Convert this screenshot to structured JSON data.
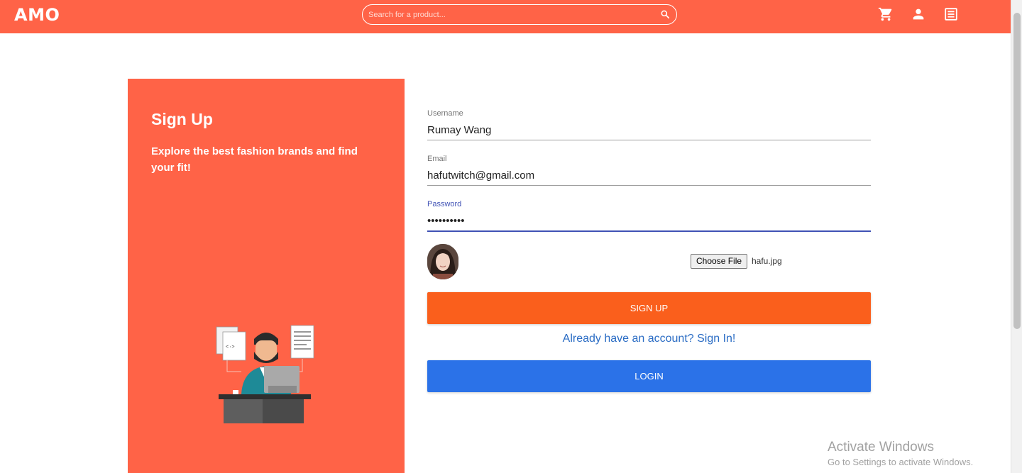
{
  "app": {
    "logo_text": "AMO",
    "brand_color": "#ff6347"
  },
  "header": {
    "search_placeholder": "Search for a product...",
    "icons": [
      "search-icon",
      "cart-icon",
      "user-icon",
      "orders-icon"
    ]
  },
  "panel": {
    "title": "Sign Up",
    "tagline": "Explore the best fashion brands and find your fit!",
    "illustration": "developer-at-desk-illustration"
  },
  "form": {
    "username": {
      "label": "Username",
      "value": "Rumay Wang"
    },
    "email": {
      "label": "Email",
      "value": "hafutwitch@gmail.com"
    },
    "password": {
      "label": "Password",
      "value": "••••••••••"
    },
    "file": {
      "button_label": "Choose File",
      "file_name": "hafu.jpg"
    },
    "signup_label": "Sign Up",
    "signin_link": "Already have an account? Sign In!",
    "login_label": "Login",
    "signup_color": "#fa5f1c",
    "login_color": "#2b72e8"
  },
  "watermark": {
    "title": "Activate Windows",
    "subtitle": "Go to Settings to activate Windows."
  }
}
